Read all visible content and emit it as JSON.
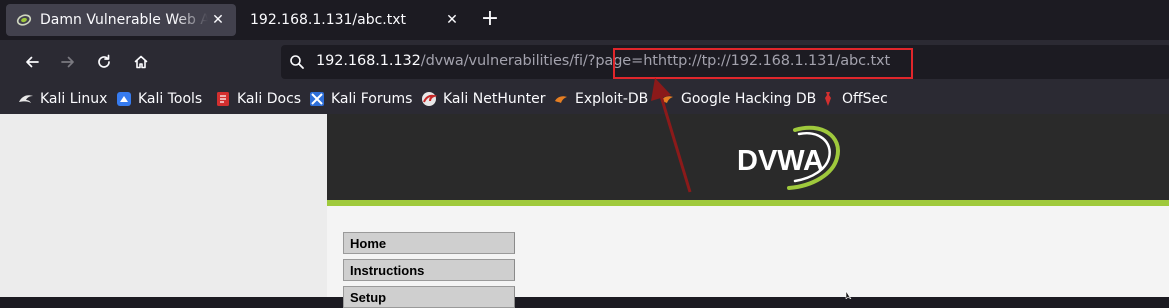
{
  "tabs": [
    {
      "title": "Damn Vulnerable Web App (DVWA)",
      "active": true,
      "icon": "dvwa-favicon"
    },
    {
      "title": "192.168.1.131/abc.txt",
      "active": false,
      "icon": "none"
    }
  ],
  "new_tab_label": "+",
  "close_glyph": "✕",
  "nav": {
    "back_icon": "back-arrow-icon",
    "forward_icon": "forward-arrow-icon",
    "reload_icon": "reload-icon",
    "home_icon": "home-icon"
  },
  "url": {
    "host": "192.168.1.132",
    "path": "/dvwa/vulnerabilities/fi/?page",
    "highlighted": "=hthttp://tp://192.168.1.131/abc.txt"
  },
  "bookmarks": [
    {
      "label": "Kali Linux",
      "icon": "kali-dragon-icon"
    },
    {
      "label": "Kali Tools",
      "icon": "kali-tools-icon"
    },
    {
      "label": "Kali Docs",
      "icon": "kali-docs-icon"
    },
    {
      "label": "Kali Forums",
      "icon": "kali-forums-icon"
    },
    {
      "label": "Kali NetHunter",
      "icon": "nethunter-icon"
    },
    {
      "label": "Exploit-DB",
      "icon": "exploit-db-icon"
    },
    {
      "label": "Google Hacking DB",
      "icon": "ghdb-icon"
    },
    {
      "label": "OffSec",
      "icon": "offsec-icon"
    }
  ],
  "dvwa": {
    "logo_text": "DVWA",
    "menu": [
      "Home",
      "Instructions",
      "Setup"
    ]
  },
  "colors": {
    "accent_green": "#9fc93c",
    "highlight_red": "#e0262b",
    "arrow_red": "#8b1a1a"
  }
}
